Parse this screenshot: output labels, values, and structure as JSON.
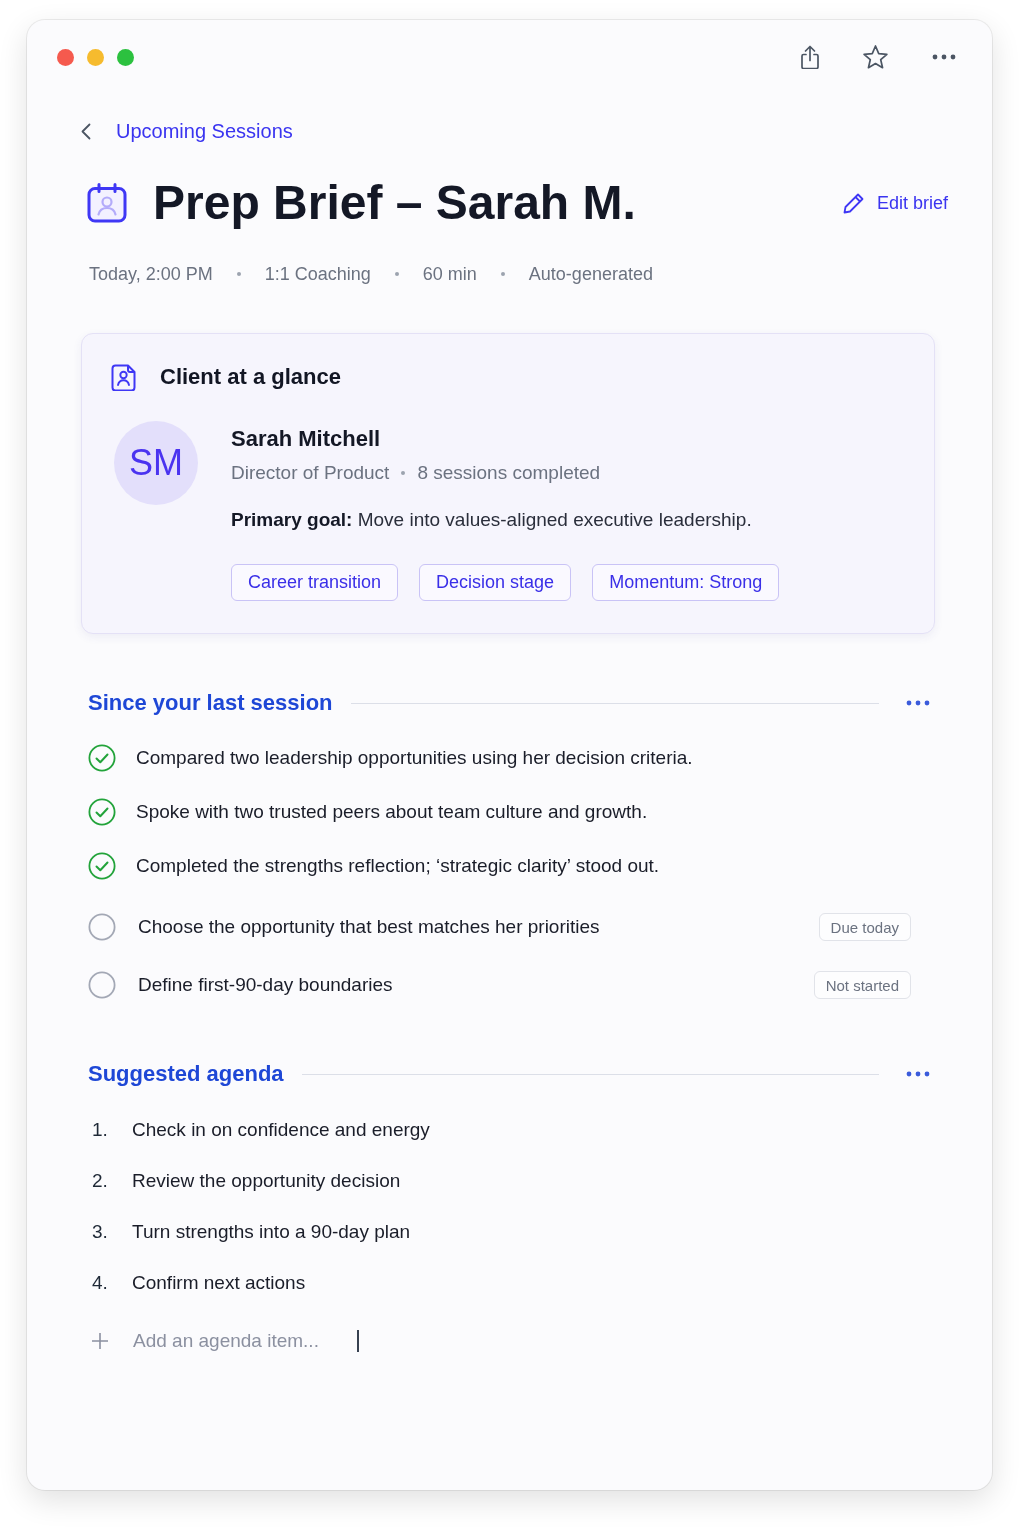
{
  "breadcrumb": {
    "label": "Upcoming Sessions"
  },
  "header": {
    "title": "Prep Brief – Sarah M.",
    "edit_label": "Edit brief",
    "meta": [
      "Today, 2:00 PM",
      "1:1 Coaching",
      "60 min",
      "Auto-generated"
    ]
  },
  "client_card": {
    "title": "Client at a glance",
    "avatar_initials": "SM",
    "name": "Sarah Mitchell",
    "role": "Director of Product",
    "sessions": "8 sessions completed",
    "goal": "**Primary goal:** Move into values-aligned executive leadership.",
    "tags": [
      "Career transition",
      "Decision stage",
      "Momentum: Strong"
    ]
  },
  "since_last_session": {
    "title": "Since your last session",
    "items": [
      {
        "text": "Compared two leadership opportunities using her decision criteria.",
        "checked": true
      },
      {
        "text": "Spoke with two trusted peers about team culture and growth.",
        "checked": true
      },
      {
        "text": "Completed the strengths reflection; ‘strategic clarity’ stood out.",
        "checked": true
      },
      {
        "text": "Choose the opportunity that best matches her priorities",
        "checked": false,
        "status": "Due today"
      },
      {
        "text": "Define first-90-day boundaries",
        "checked": false,
        "status": "Not started"
      }
    ]
  },
  "agenda": {
    "title": "Suggested agenda",
    "items": [
      {
        "number": "1.",
        "text": "Check in on confidence and energy"
      },
      {
        "number": "2.",
        "text": "Review the opportunity decision"
      },
      {
        "number": "3.",
        "text": "Turn strengths into a 90-day plan"
      },
      {
        "number": "4.",
        "text": "Confirm next actions"
      }
    ],
    "add_item": {
      "placeholder": "Add an agenda item..."
    }
  }
}
